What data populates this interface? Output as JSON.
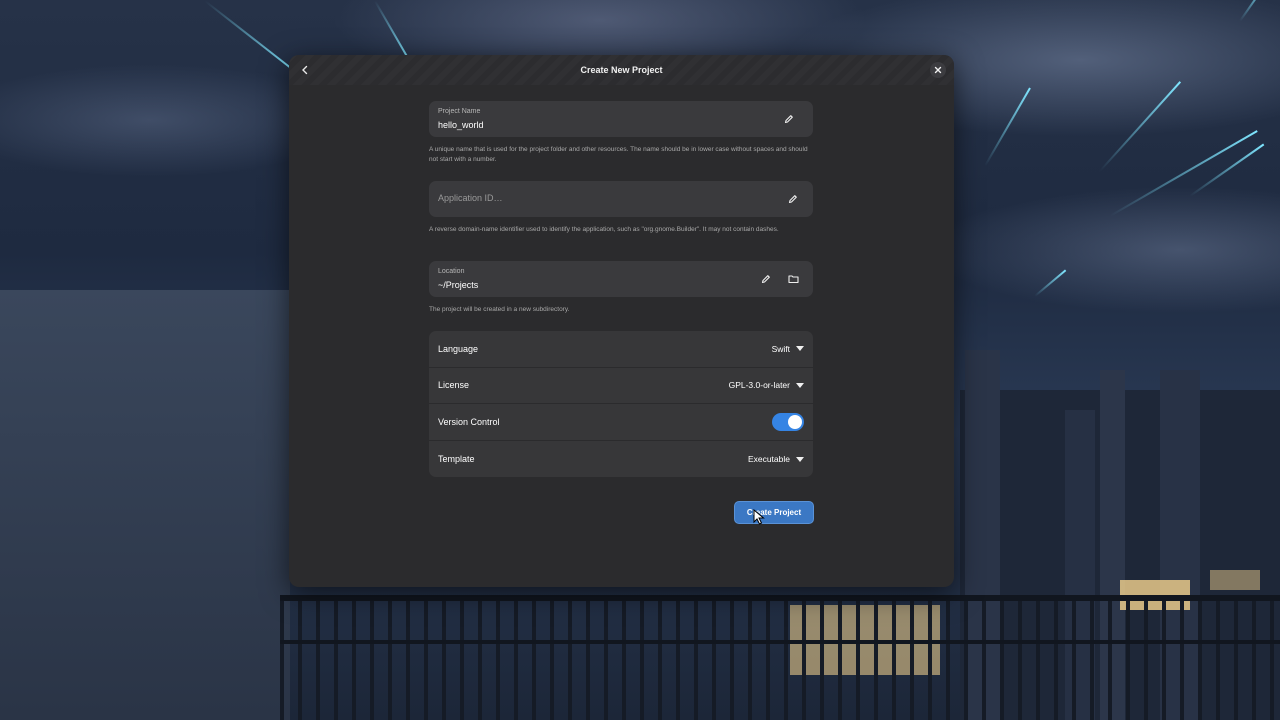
{
  "dialog": {
    "title": "Create New Project",
    "back_icon": "chevron-left-icon",
    "close_icon": "close-icon"
  },
  "project_name": {
    "label": "Project Name",
    "value": "hello_world",
    "icon": "pencil-icon",
    "help": "A unique name that is used for the project folder and other resources. The name should be in lower case without spaces and should not start with a number."
  },
  "application_id": {
    "placeholder": "Application ID…",
    "icon": "pencil-icon",
    "help": "A reverse domain-name identifier used to identify the application, such as \"org.gnome.Builder\". It may not contain dashes."
  },
  "location": {
    "label": "Location",
    "value": "~/Projects",
    "icons": [
      "pencil-icon",
      "folder-icon"
    ],
    "help": "The project will be created in a new subdirectory."
  },
  "options": {
    "language": {
      "label": "Language",
      "value": "Swift"
    },
    "license": {
      "label": "License",
      "value": "GPL-3.0-or-later"
    },
    "version_control": {
      "label": "Version Control",
      "enabled": true
    },
    "template": {
      "label": "Template",
      "value": "Executable"
    }
  },
  "actions": {
    "create_label": "Create Project"
  },
  "colors": {
    "accent": "#3584e4",
    "dialog_bg": "#2b2b2d",
    "row_bg": "#373739"
  }
}
